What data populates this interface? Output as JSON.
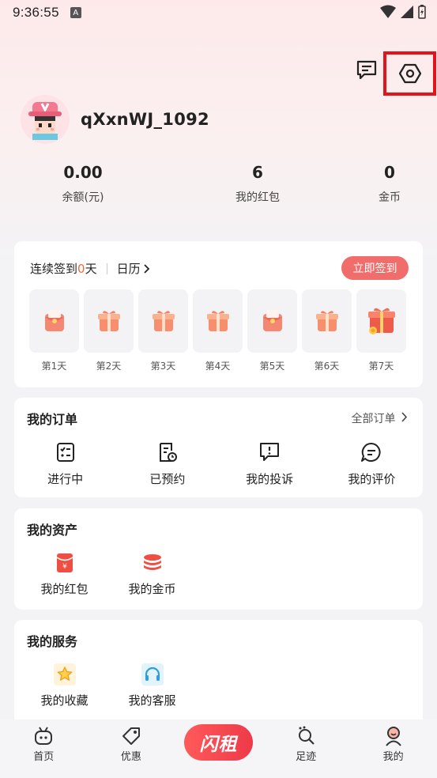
{
  "status_bar": {
    "time": "9:36:55",
    "badge": "A"
  },
  "profile": {
    "username": "qXxnWJ_1092"
  },
  "stats": [
    {
      "value": "0.00",
      "label": "余额(元)"
    },
    {
      "value": "6",
      "label": "我的红包"
    },
    {
      "value": "0",
      "label": "金币"
    }
  ],
  "signin": {
    "prefix": "连续签到",
    "count": "0",
    "suffix": "天",
    "calendar": "日历",
    "button": "立即签到",
    "days": [
      "第1天",
      "第2天",
      "第3天",
      "第4天",
      "第5天",
      "第6天",
      "第7天"
    ],
    "day_icons": [
      "red-envelope-icon",
      "gift-box-icon",
      "gift-box-icon",
      "gift-box-icon",
      "red-envelope-icon",
      "gift-box-icon",
      "big-gift-icon"
    ]
  },
  "orders": {
    "title": "我的订单",
    "all_link": "全部订单",
    "items": [
      {
        "label": "进行中",
        "icon": "checklist-icon"
      },
      {
        "label": "已预约",
        "icon": "reserved-doc-icon"
      },
      {
        "label": "我的投诉",
        "icon": "complaint-icon"
      },
      {
        "label": "我的评价",
        "icon": "comment-icon"
      }
    ]
  },
  "assets": {
    "title": "我的资产",
    "items": [
      {
        "label": "我的红包",
        "icon": "red-packet-icon"
      },
      {
        "label": "我的金币",
        "icon": "coin-stack-icon"
      }
    ]
  },
  "services": {
    "title": "我的服务",
    "items": [
      {
        "label": "我的收藏",
        "icon": "star-icon"
      },
      {
        "label": "我的客服",
        "icon": "headset-icon"
      }
    ]
  },
  "tabbar": {
    "items": [
      {
        "label": "首页",
        "icon": "home-icon"
      },
      {
        "label": "优惠",
        "icon": "tag-icon"
      },
      {
        "label": "足迹",
        "icon": "footprint-icon"
      },
      {
        "label": "我的",
        "icon": "profile-icon"
      }
    ],
    "center_label": "闪租"
  },
  "colors": {
    "accent": "#f16d6b",
    "highlight": "#e3131b",
    "orange": "#f26b3a"
  }
}
